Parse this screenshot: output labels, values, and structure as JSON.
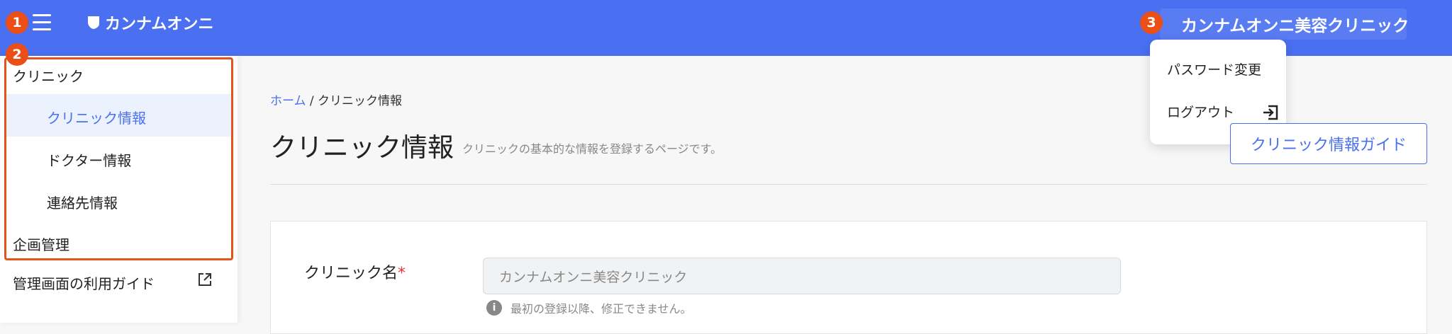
{
  "header": {
    "logo_text": "カンナムオンニ",
    "user_name": "カンナムオンニ美容クリニック",
    "brand_color": "#4a6ff0"
  },
  "annotations": {
    "badge1": "1",
    "badge2": "2",
    "badge3": "3"
  },
  "user_menu": {
    "password_change": "パスワード変更",
    "logout": "ログアウト"
  },
  "sidebar": {
    "clinic": "クリニック",
    "clinic_info": "クリニック情報",
    "doctor_info": "ドクター情報",
    "contact_info": "連絡先情報",
    "planning": "企画管理",
    "guide": "管理画面の利用ガイド"
  },
  "breadcrumb": {
    "home": "ホーム",
    "separator": " / ",
    "current": "クリニック情報"
  },
  "page": {
    "title": "クリニック情報",
    "description": "クリニックの基本的な情報を登録するページです。",
    "guide_button": "クリニック情報ガイド"
  },
  "form": {
    "clinic_name_label": "クリニック名",
    "required_mark": "*",
    "clinic_name_value": "カンナムオンニ美容クリニック",
    "clinic_name_help": "最初の登録以降、修正できません。"
  },
  "icons": {
    "menu": "hamburger-icon",
    "logo": "logo-icon",
    "logout": "logout-icon",
    "external": "external-link-icon",
    "info": "info-icon"
  }
}
